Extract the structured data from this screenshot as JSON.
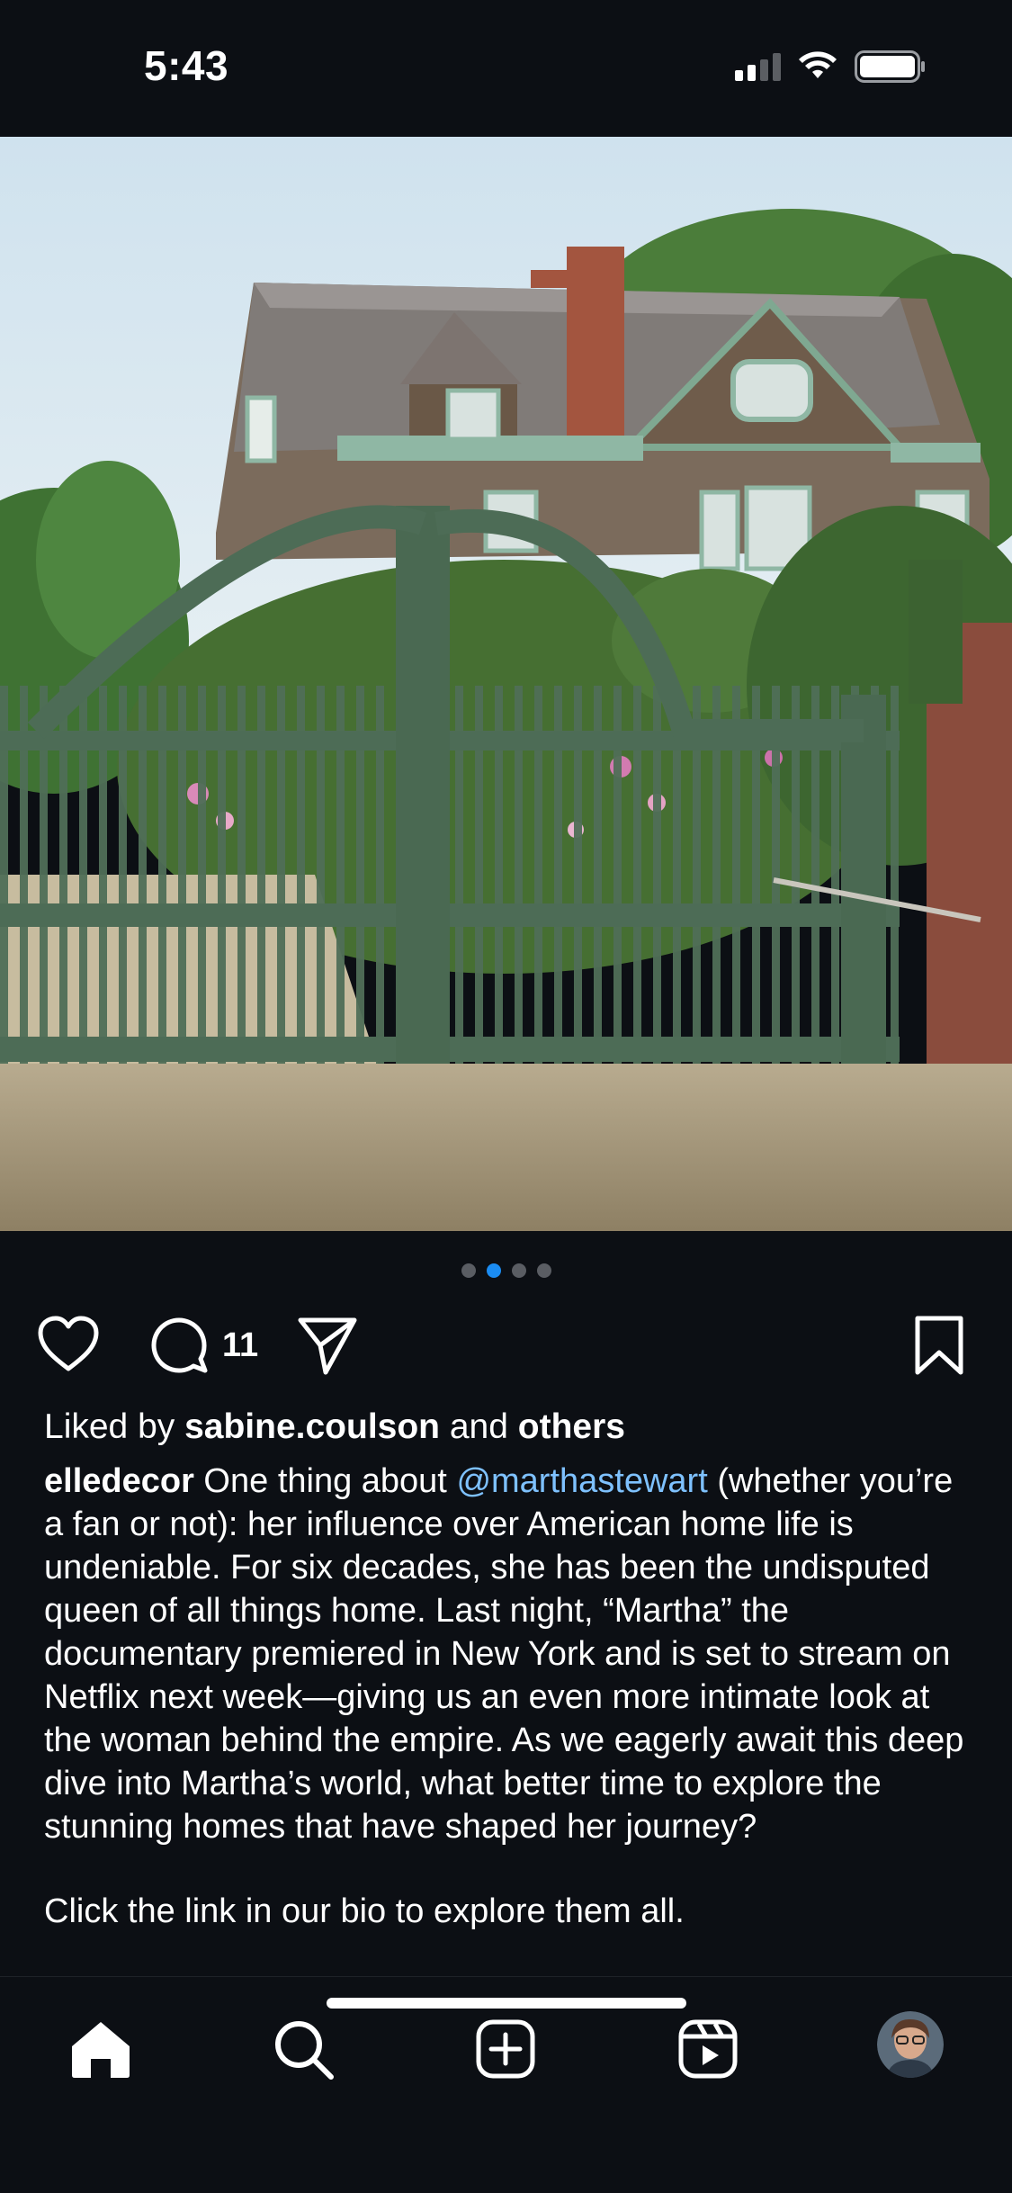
{
  "status_bar": {
    "time": "5:43",
    "icons": [
      "cellular-signal-icon",
      "wifi-icon",
      "battery-icon"
    ]
  },
  "post": {
    "image_alt": "house-behind-green-gate-photo",
    "carousel": {
      "total": 4,
      "active_index": 1
    },
    "actions": {
      "comment_count": "11",
      "icons": [
        "heart-icon",
        "comment-icon",
        "share-icon",
        "bookmark-icon"
      ]
    },
    "likes": {
      "prefix": "Liked by",
      "user": "sabine.coulson",
      "conjunction": "and",
      "others": "others"
    },
    "caption": {
      "username": "elledecor",
      "text_before_mention": " One thing about ",
      "mention": "@marthastewart",
      "text_after_mention": " (whether you’re a fan or not): her influence over American home life is undeniable. For six decades, she has been the undisputed queen of all things home. Last night, “Martha” the documentary premiered in New York and is set to stream on Netflix next week—giving us an even more intimate look at the woman behind the empire. As we eagerly await this deep dive into Martha’s world, what better time to explore the stunning homes that have shaped her journey?",
      "partial_line": "Click the link in our bio to explore them all."
    }
  },
  "bottom_nav": {
    "items": [
      "home-icon",
      "search-icon",
      "create-post-icon",
      "reels-icon",
      "profile-avatar"
    ]
  },
  "colors": {
    "background": "#0c0f14",
    "text": "#ffffff",
    "mention": "#7ec1ff",
    "active_dot": "#1b8cf2",
    "inactive_dot": "#5a5d63"
  }
}
